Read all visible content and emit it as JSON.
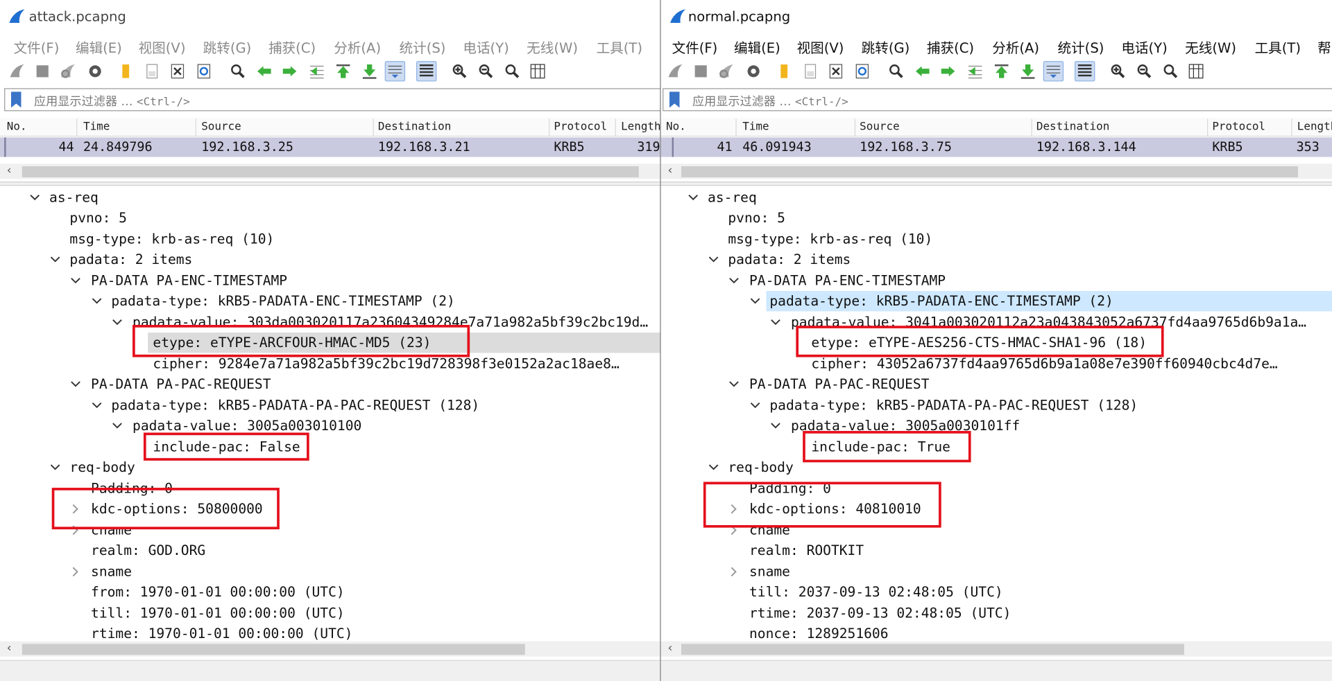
{
  "colors": {
    "accent_red": "#e4101c",
    "selected_row": "#c9c9df",
    "field_highlight_grey": "#dcdcdc",
    "field_highlight_blue": "#cde8ff",
    "filter_bookmark": "#3a74c7"
  },
  "left": {
    "title": "attack.pcapng",
    "menu": [
      "文件(F)",
      "编辑(E)",
      "视图(V)",
      "跳转(G)",
      "捕获(C)",
      "分析(A)",
      "统计(S)",
      "电话(Y)",
      "无线(W)",
      "工具(T)"
    ],
    "filter": {
      "placeholder": "应用显示过滤器 …",
      "shortcut": "<Ctrl-/>"
    },
    "columns": [
      "No.",
      "Time",
      "Source",
      "Destination",
      "Protocol",
      "Length"
    ],
    "packet": {
      "no": "44",
      "time": "24.849796",
      "source": "192.168.3.25",
      "destination": "192.168.3.21",
      "protocol": "KRB5",
      "length": "319"
    },
    "details": {
      "as_req": "as-req",
      "pvno": "pvno: 5",
      "msg_type": "msg-type: krb-as-req (10)",
      "padata": "padata: 2 items",
      "pa_data_enc": "PA-DATA PA-ENC-TIMESTAMP",
      "padata_type_enc": "padata-type: kRB5-PADATA-ENC-TIMESTAMP (2)",
      "padata_value_enc": "padata-value: 303da003020117a23604349284e7a71a982a5bf39c2bc19d…",
      "etype": "etype: eTYPE-ARCFOUR-HMAC-MD5 (23)",
      "cipher": "cipher: 9284e7a71a982a5bf39c2bc19d728398f3e0152a2ac18ae8…",
      "pa_data_pac": "PA-DATA PA-PAC-REQUEST",
      "padata_type_pac": "padata-type: kRB5-PADATA-PA-PAC-REQUEST (128)",
      "padata_value_pac": "padata-value: 3005a003010100",
      "include_pac": "include-pac: False",
      "req_body": "req-body",
      "padding": "Padding: 0",
      "kdc_options": "kdc-options: 50800000",
      "cname": "cname",
      "realm": "realm: GOD.ORG",
      "sname": "sname",
      "from": "from: 1970-01-01 00:00:00 (UTC)",
      "till": "till: 1970-01-01 00:00:00 (UTC)",
      "rtime": "rtime: 1970-01-01 00:00:00 (UTC)"
    }
  },
  "right": {
    "title": "normal.pcapng",
    "menu": [
      "文件(F)",
      "编辑(E)",
      "视图(V)",
      "跳转(G)",
      "捕获(C)",
      "分析(A)",
      "统计(S)",
      "电话(Y)",
      "无线(W)",
      "工具(T)",
      "帮"
    ],
    "filter": {
      "placeholder": "应用显示过滤器 …",
      "shortcut": "<Ctrl-/>"
    },
    "columns": [
      "No.",
      "Time",
      "Source",
      "Destination",
      "Protocol",
      "Length"
    ],
    "packet": {
      "no": "41",
      "time": "46.091943",
      "source": "192.168.3.75",
      "destination": "192.168.3.144",
      "protocol": "KRB5",
      "length": "353"
    },
    "details": {
      "as_req": "as-req",
      "pvno": "pvno: 5",
      "msg_type": "msg-type: krb-as-req (10)",
      "padata": "padata: 2 items",
      "pa_data_enc": "PA-DATA PA-ENC-TIMESTAMP",
      "padata_type_enc": "padata-type: kRB5-PADATA-ENC-TIMESTAMP (2)",
      "padata_value_enc": "padata-value: 3041a003020112a23a043843052a6737fd4aa9765d6b9a1a…",
      "etype": "etype: eTYPE-AES256-CTS-HMAC-SHA1-96 (18)",
      "cipher": "cipher: 43052a6737fd4aa9765d6b9a1a08e7e390ff60940cbc4d7e…",
      "pa_data_pac": "PA-DATA PA-PAC-REQUEST",
      "padata_type_pac": "padata-type: kRB5-PADATA-PA-PAC-REQUEST (128)",
      "padata_value_pac": "padata-value: 3005a0030101ff",
      "include_pac": "include-pac: True",
      "req_body": "req-body",
      "padding": "Padding: 0",
      "kdc_options": "kdc-options: 40810010",
      "cname": "cname",
      "realm": "realm: ROOTKIT",
      "sname": "sname",
      "till": "till: 2037-09-13 02:48:05 (UTC)",
      "rtime": "rtime: 2037-09-13 02:48:05 (UTC)",
      "nonce": "nonce: 1289251606"
    }
  }
}
